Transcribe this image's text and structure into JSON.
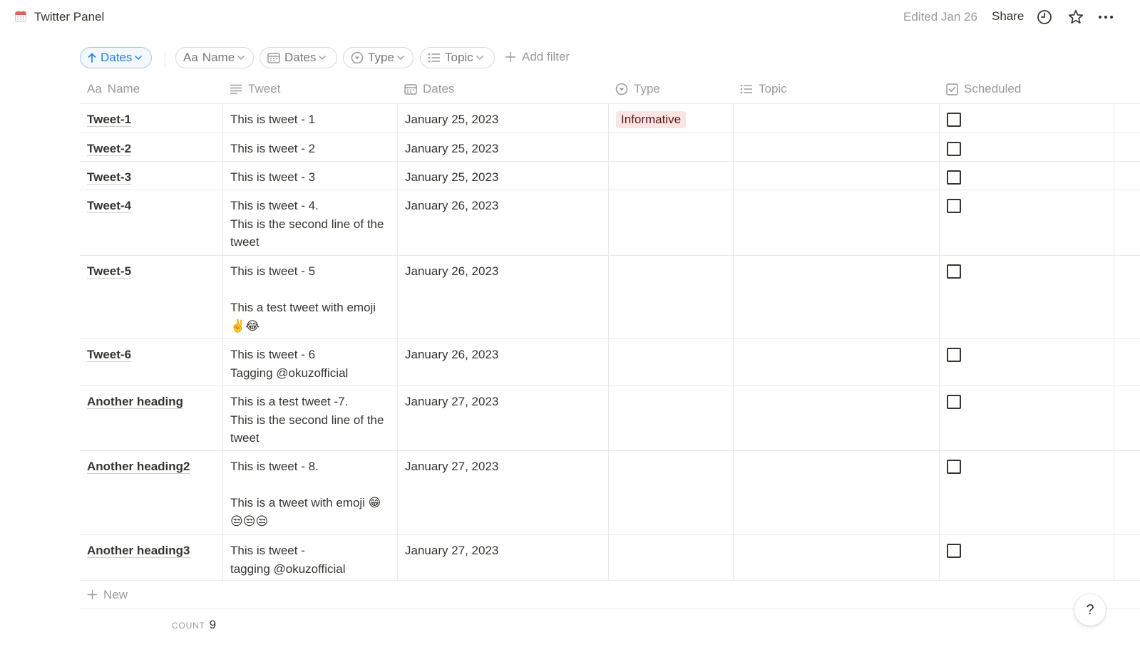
{
  "header": {
    "page_icon": "calendar-icon",
    "title": "Twitter Panel",
    "edited": "Edited Jan 26",
    "share_label": "Share",
    "icons": [
      "clock-icon",
      "star-icon",
      "more-icon"
    ]
  },
  "filters": {
    "sort_label": "Dates",
    "chips": [
      "Name",
      "Dates",
      "Type",
      "Topic"
    ],
    "name_prefix": "Aa",
    "add_filter_label": "Add filter"
  },
  "table": {
    "columns": {
      "name": "Name",
      "name_prefix": "Aa",
      "tweet": "Tweet",
      "dates": "Dates",
      "type": "Type",
      "topic": "Topic",
      "scheduled": "Scheduled"
    },
    "rows": [
      {
        "name": "Tweet-1",
        "tweet": "This is tweet - 1",
        "date": "January 25, 2023",
        "type": "Informative",
        "topic": "",
        "scheduled": false
      },
      {
        "name": "Tweet-2",
        "tweet": "This is tweet - 2",
        "date": "January 25, 2023",
        "type": "",
        "topic": "",
        "scheduled": false
      },
      {
        "name": "Tweet-3",
        "tweet": "This is tweet - 3",
        "date": "January 25, 2023",
        "type": "",
        "topic": "",
        "scheduled": false
      },
      {
        "name": "Tweet-4",
        "tweet": "This is tweet - 4.\nThis is the second line of the tweet",
        "date": "January 26, 2023",
        "type": "",
        "topic": "",
        "scheduled": false
      },
      {
        "name": "Tweet-5",
        "tweet": "This is tweet - 5\n\nThis a test tweet with emoji\n✌️😂",
        "date": "January 26, 2023",
        "type": "",
        "topic": "",
        "scheduled": false
      },
      {
        "name": "Tweet-6",
        "tweet": "This is tweet - 6\nTagging @okuzofficial",
        "date": "January 26, 2023",
        "type": "",
        "topic": "",
        "scheduled": false
      },
      {
        "name": "Another heading",
        "tweet": "This is a test tweet -7.\nThis is the second line of the tweet",
        "date": "January 27, 2023",
        "type": "",
        "topic": "",
        "scheduled": false
      },
      {
        "name": "Another heading2",
        "tweet": "This is tweet - 8.\n\nThis is a tweet with emoji 😁\n😒😒😒",
        "date": "January 27, 2023",
        "type": "",
        "topic": "",
        "scheduled": false
      },
      {
        "name": "Another heading3",
        "tweet": "This is tweet -\ntagging @okuzofficial",
        "date": "January 27, 2023",
        "type": "",
        "topic": "",
        "scheduled": false
      }
    ],
    "new_label": "New"
  },
  "footer": {
    "count_label": "COUNT",
    "count_value": "9"
  },
  "help_label": "?",
  "colors": {
    "accent": "#2383e2",
    "tag_bg": "#fbe4e4",
    "tag_text": "#5d1715",
    "muted": "#9b9a97"
  }
}
